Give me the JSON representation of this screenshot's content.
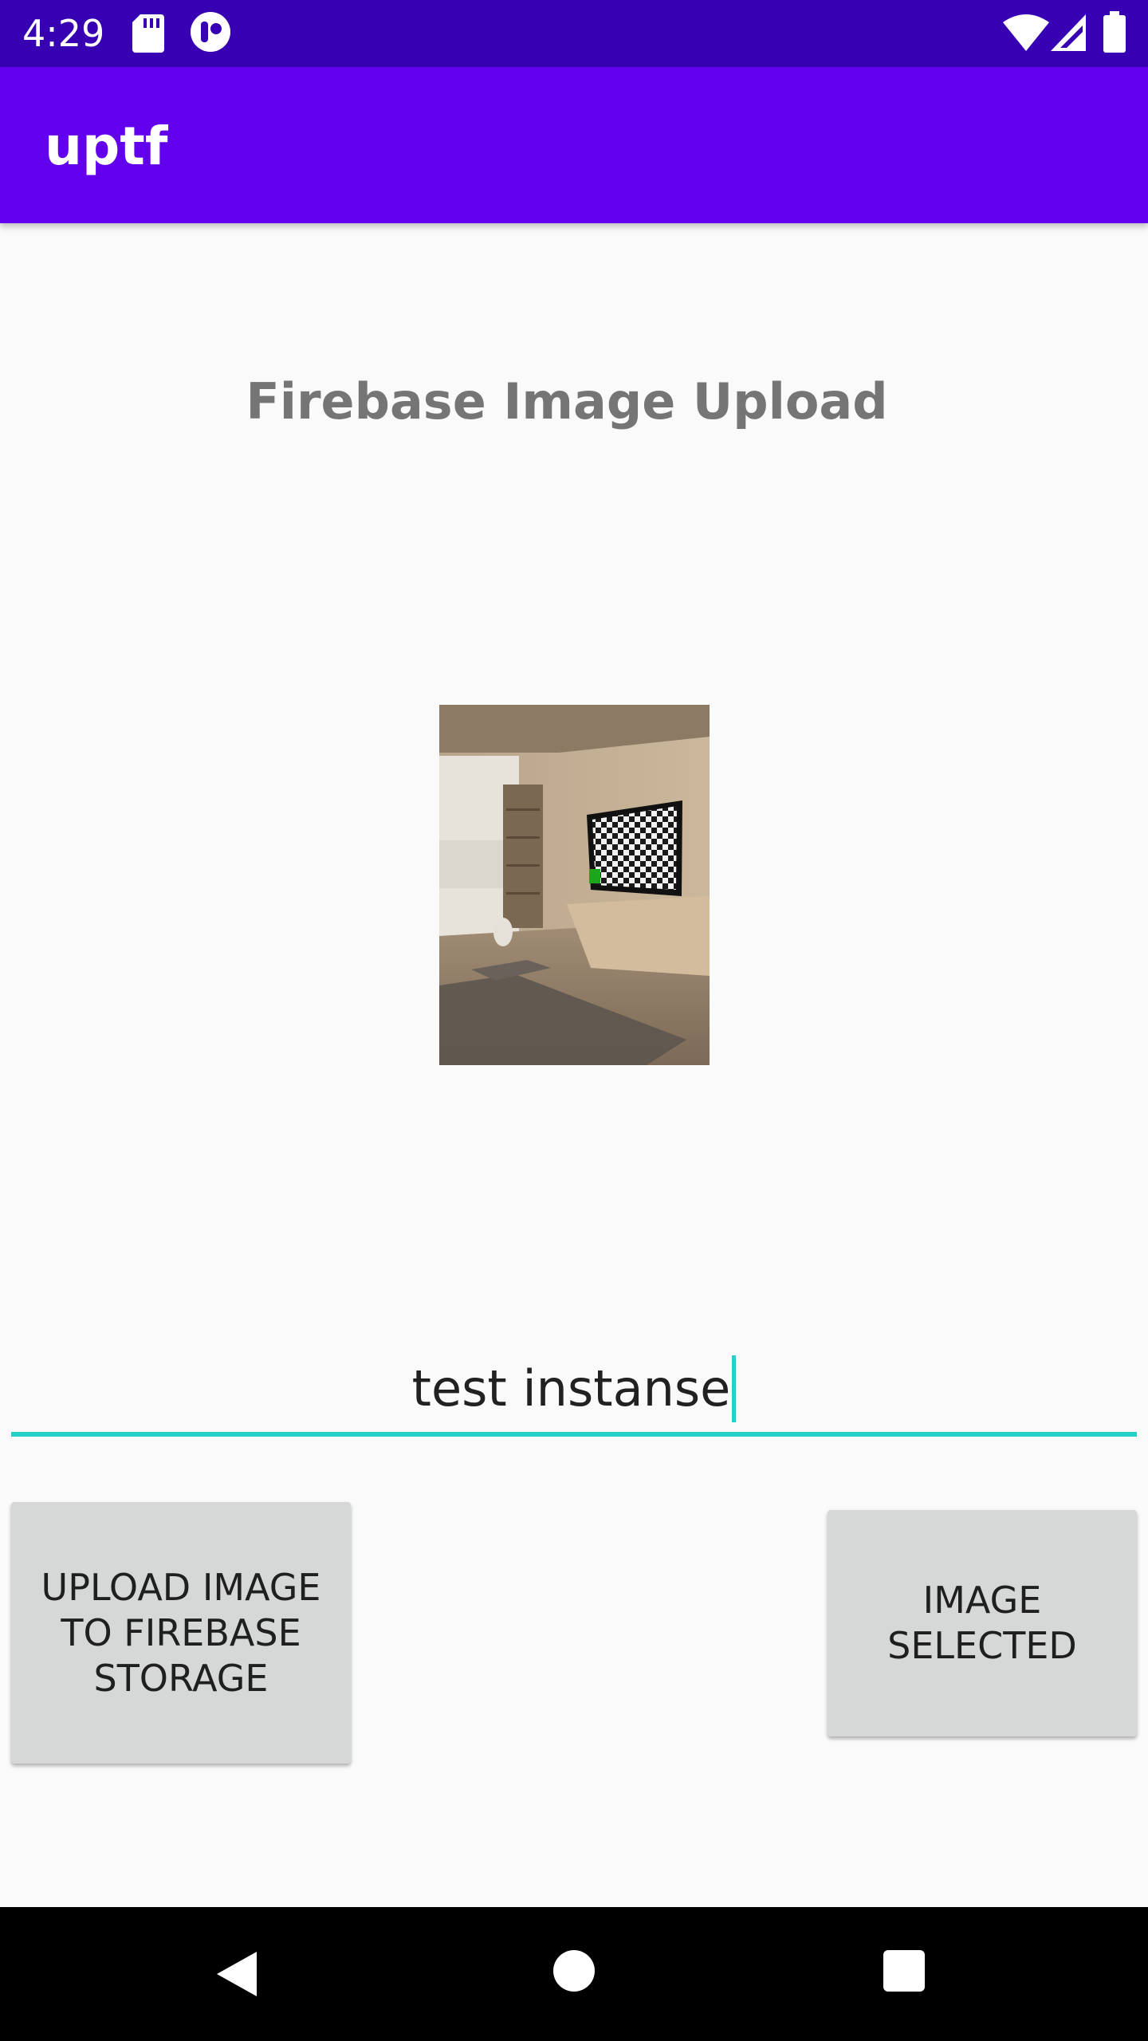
{
  "status_bar": {
    "time": "4:29",
    "left_icons": [
      "sd-card-icon",
      "notification-app-icon"
    ],
    "right_icons": [
      "wifi-icon",
      "cellular-signal-icon",
      "battery-icon"
    ]
  },
  "app_bar": {
    "title": "uptf"
  },
  "main": {
    "heading": "Firebase Image Upload",
    "preview_image": {
      "description_icon": "selected-image-preview"
    },
    "caption_input": {
      "value": "test instanse"
    },
    "upload_button": {
      "label": "UPLOAD IMAGE\nTO FIREBASE\nSTORAGE"
    },
    "select_button": {
      "label": "IMAGE\nSELECTED"
    }
  },
  "nav_bar": {
    "icons": [
      "back-icon",
      "home-icon",
      "recents-icon"
    ]
  },
  "colors": {
    "status_bar": "#3700b3",
    "app_bar": "#6200ee",
    "accent": "#26d0c9",
    "button_bg": "#d6d7d7",
    "heading_text": "#757575"
  }
}
